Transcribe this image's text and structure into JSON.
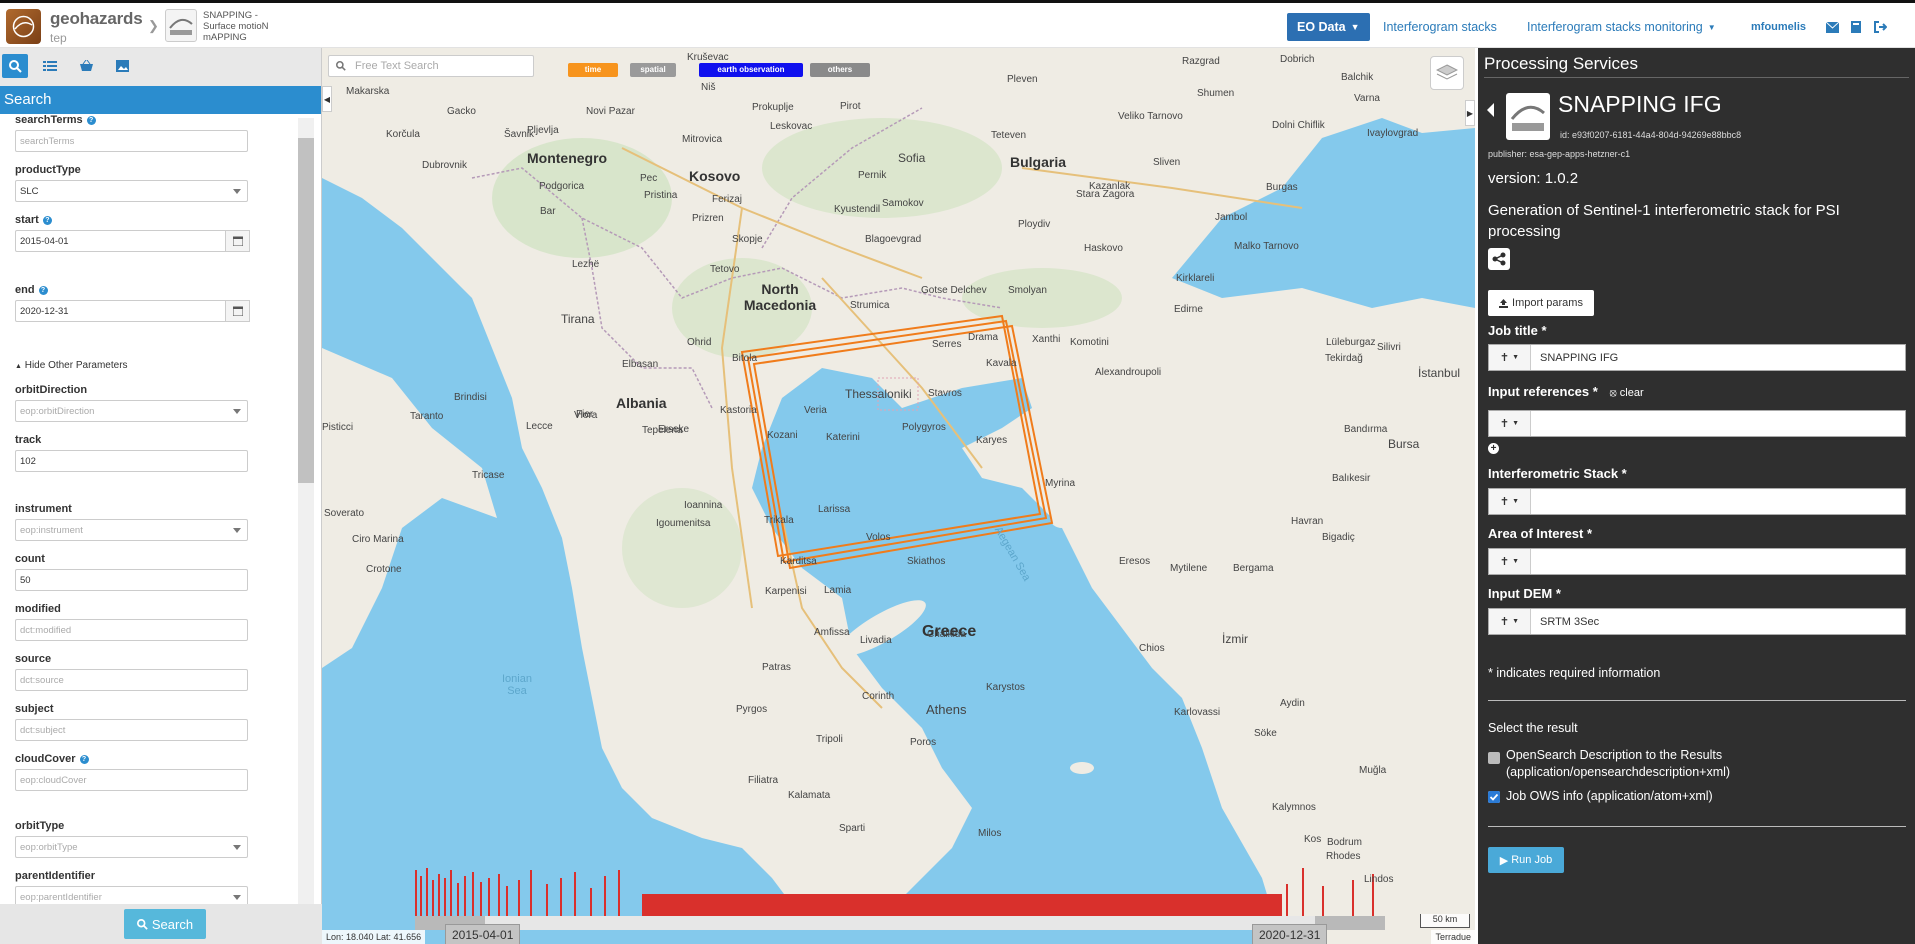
{
  "header": {
    "logo_text": "geohazards",
    "logo_sub": "tep",
    "app_title": "SNAPPING - Surface motioN mAPPING",
    "eo_data": "EO Data",
    "nav_stacks": "Interferogram stacks",
    "nav_monitoring": "Interferogram stacks monitoring",
    "user": "mfoumelis"
  },
  "left": {
    "panel_title": "Search",
    "fields": {
      "searchTerms": {
        "label": "searchTerms",
        "placeholder": "searchTerms"
      },
      "productType": {
        "label": "productType",
        "value": "SLC"
      },
      "start": {
        "label": "start",
        "value": "2015-04-01"
      },
      "end": {
        "label": "end",
        "value": "2020-12-31"
      },
      "hide_other": "Hide Other Parameters",
      "orbitDirection": {
        "label": "orbitDirection",
        "placeholder": "eop:orbitDirection"
      },
      "track": {
        "label": "track",
        "value": "102"
      },
      "instrument": {
        "label": "instrument",
        "placeholder": "eop:instrument"
      },
      "count": {
        "label": "count",
        "value": "50"
      },
      "modified": {
        "label": "modified",
        "placeholder": "dct:modified"
      },
      "source": {
        "label": "source",
        "placeholder": "dct:source"
      },
      "subject": {
        "label": "subject",
        "placeholder": "dct:subject"
      },
      "cloudCover": {
        "label": "cloudCover",
        "placeholder": "eop:cloudCover"
      },
      "orbitType": {
        "label": "orbitType",
        "placeholder": "eop:orbitType"
      },
      "parentIdentifier": {
        "label": "parentIdentifier",
        "placeholder": "eop:parentIdentifier"
      }
    },
    "search_button": "Search"
  },
  "map": {
    "free_text_placeholder": "Free Text Search",
    "chips": [
      {
        "label": "time",
        "color": "#f7941d"
      },
      {
        "label": "spatial",
        "color": "#9a9a9a"
      },
      {
        "label": "earth observation",
        "color": "#1010ee"
      },
      {
        "label": "others",
        "color": "#8a8a8a"
      }
    ],
    "coords": "Lon: 18.040 Lat: 41.656",
    "attribution": "Terradue",
    "scale": "50 km",
    "timeline_start": "2015-04-01",
    "timeline_end": "2020-12-31",
    "labels": {
      "countries": [
        "Montenegro",
        "Kosovo",
        "Bulgaria",
        "North Macedonia",
        "Albania",
        "Greece"
      ],
      "cities": [
        "Kruševac",
        "Niš",
        "Pleven",
        "Dobrich",
        "Balchik",
        "Razgrad",
        "Shumen",
        "Makarska",
        "Varna",
        "Novi Pazar",
        "Gacko",
        "Pljevlja",
        "Prokuplje",
        "Veliko Tarnovo",
        "Ivaylovgrad",
        "Korčula",
        "Šavnik",
        "Leskovac",
        "Pirot",
        "Teteven",
        "Dolni Chiflik",
        "Dubrovnik",
        "Mitrovica",
        "Sofia",
        "Burgas",
        "Sliven",
        "Pec",
        "Podgorica",
        "Bar",
        "Pristina",
        "Pernik",
        "Kazanlak",
        "Stara Zagora",
        "Ferizaj",
        "Kyustendil",
        "Samokov",
        "Ploydiv",
        "Jambol",
        "Prizren",
        "Blagoevgrad",
        "Haskovo",
        "Malko Tarnovo",
        "Skopje",
        "Tetovo",
        "Lezhë",
        "Gotse Delchev",
        "Smolyan",
        "Kirklareli",
        "Strumica",
        "Edirne",
        "Tirana",
        "Ohrid",
        "Serres",
        "Drama",
        "Xanthi",
        "Komotini",
        "Lüleburgaz",
        "Silivri",
        "İstanbul",
        "Elbasan",
        "Bitola",
        "Kavala",
        "Alexandroupoli",
        "Tekirdağ",
        "Brindisi",
        "Lecce",
        "Fier",
        "Kastoria",
        "Veria",
        "Thessaloniki",
        "Stavros",
        "Polygyros",
        "Karyes",
        "Bandırma",
        "Bursa",
        "Taranto",
        "Vlora",
        "Erseke",
        "Kozani",
        "Katerini",
        "Tepelena",
        "Pisticci",
        "Balıkesir",
        "Tricase",
        "Ioannina",
        "Larissa",
        "Myrina",
        "Havran",
        "Igoumenitsa",
        "Trikala",
        "Volos",
        "Skiathos",
        "Bigadiç",
        "Soverato",
        "Ciro Marina",
        "Crotone",
        "Karditsa",
        "Lamia",
        "Eresos",
        "Mytilene",
        "Bergama",
        "Karpenisi",
        "Amfissa",
        "Livadia",
        "Chalkida",
        "Chios",
        "İzmir",
        "Patras",
        "Corinth",
        "Athens",
        "Karystos",
        "Aydin",
        "Pyrgos",
        "Tripoli",
        "Poros",
        "Karlovassi",
        "Söke",
        "Kalamata",
        "Filiatra",
        "Kalymnos",
        "Bodrum",
        "Muğla",
        "Sparti",
        "Milos",
        "Kos",
        "Rhodes",
        "Lindos"
      ],
      "seas": [
        "Ionian Sea",
        "Aegean Sea"
      ]
    }
  },
  "right": {
    "title": "Processing Services",
    "service_name": "SNAPPING IFG",
    "service_id": "id: e93f0207-6181-44a4-804d-94269e88bbc8",
    "publisher": "publisher: esa-gep-apps-hetzner-c1",
    "version": "version: 1.0.2",
    "description": "Generation of Sentinel-1 interferometric stack for PSI processing",
    "import_params": "Import params",
    "job_title_label": "Job title *",
    "job_title_value": "SNAPPING IFG",
    "input_refs_label": "Input references *",
    "clear": "clear",
    "interf_stack_label": "Interferometric Stack *",
    "aoi_label": "Area of Interest *",
    "dem_label": "Input DEM *",
    "dem_value": "SRTM 3Sec",
    "required_note": "* indicates required information",
    "select_result": "Select the result",
    "opt1": "OpenSearch Description to the Results (application/opensearchdescription+xml)",
    "opt2": "Job OWS info (application/atom+xml)",
    "run_job": "Run Job"
  }
}
